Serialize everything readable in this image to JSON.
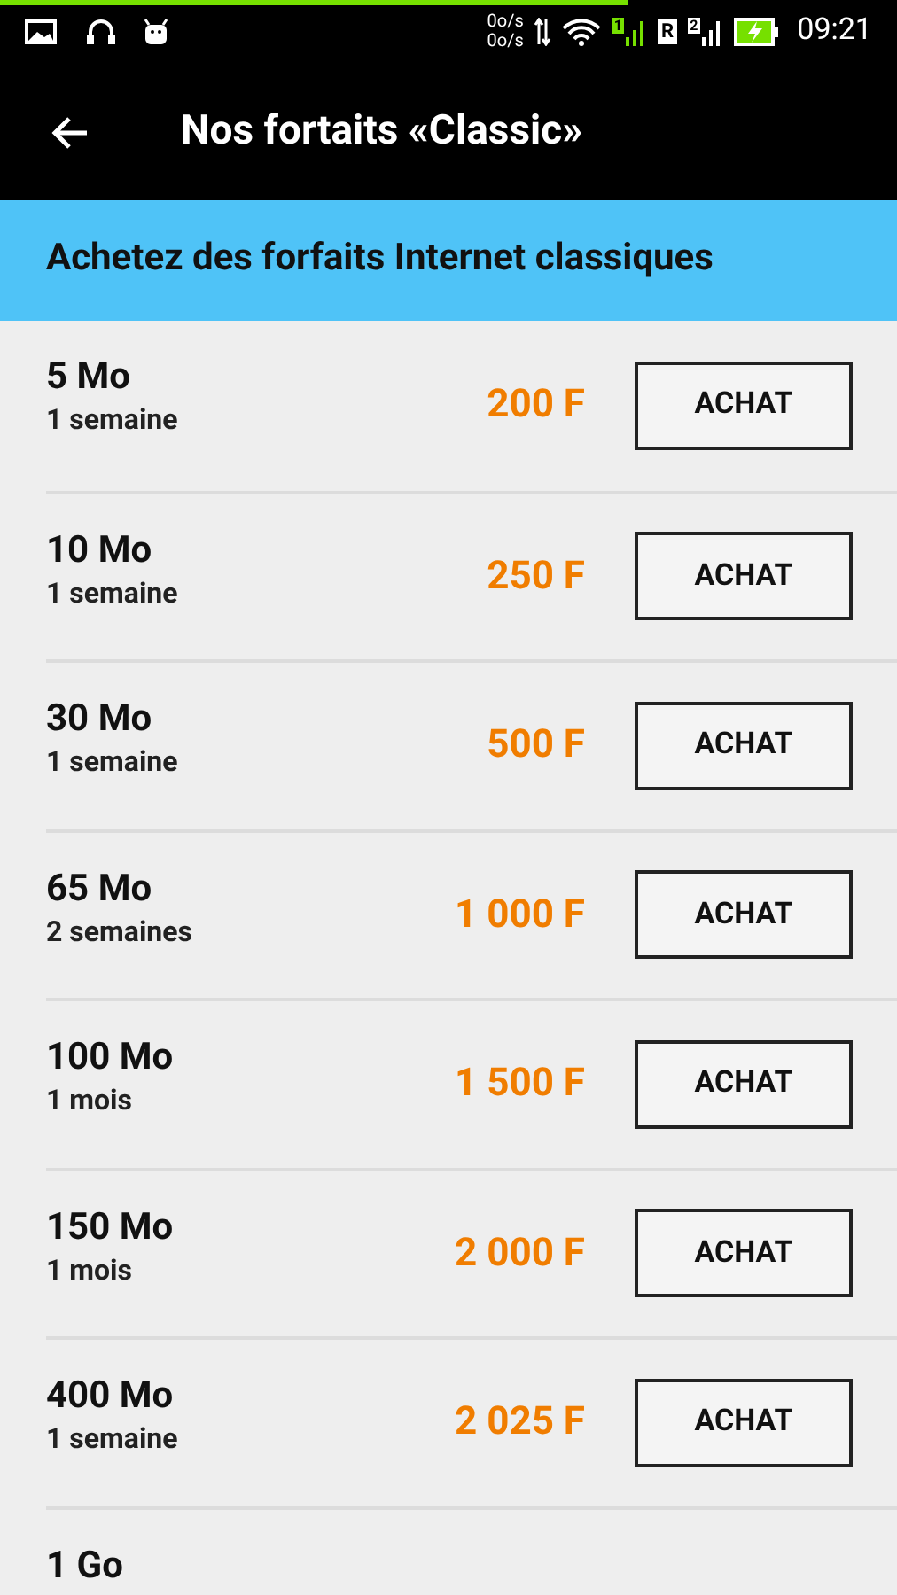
{
  "status_bar": {
    "loading": {
      "level": 0.7
    },
    "upload_speed": "0o/s",
    "download_speed": "0o/s",
    "sim1": "1",
    "roaming": "R",
    "sim2": "2",
    "time": "09:21"
  },
  "toolbar": {
    "title": "Nos fortaits «Classic»"
  },
  "banner": {
    "text": "Achetez des forfaits Internet classiques"
  },
  "plans": [
    {
      "volume": "5 Mo",
      "duration": "1 semaine",
      "price": "200 F",
      "button": "ACHAT"
    },
    {
      "volume": "10 Mo",
      "duration": "1 semaine",
      "price": "250 F",
      "button": "ACHAT"
    },
    {
      "volume": "30 Mo",
      "duration": "1 semaine",
      "price": "500 F",
      "button": "ACHAT"
    },
    {
      "volume": "65 Mo",
      "duration": "2 semaines",
      "price": "1 000 F",
      "button": "ACHAT"
    },
    {
      "volume": "100 Mo",
      "duration": "1 mois",
      "price": "1 500 F",
      "button": "ACHAT"
    },
    {
      "volume": "150 Mo",
      "duration": "1 mois",
      "price": "2 000 F",
      "button": "ACHAT"
    },
    {
      "volume": "400 Mo",
      "duration": "1 semaine",
      "price": "2 025 F",
      "button": "ACHAT"
    },
    {
      "volume": "1 Go"
    }
  ]
}
